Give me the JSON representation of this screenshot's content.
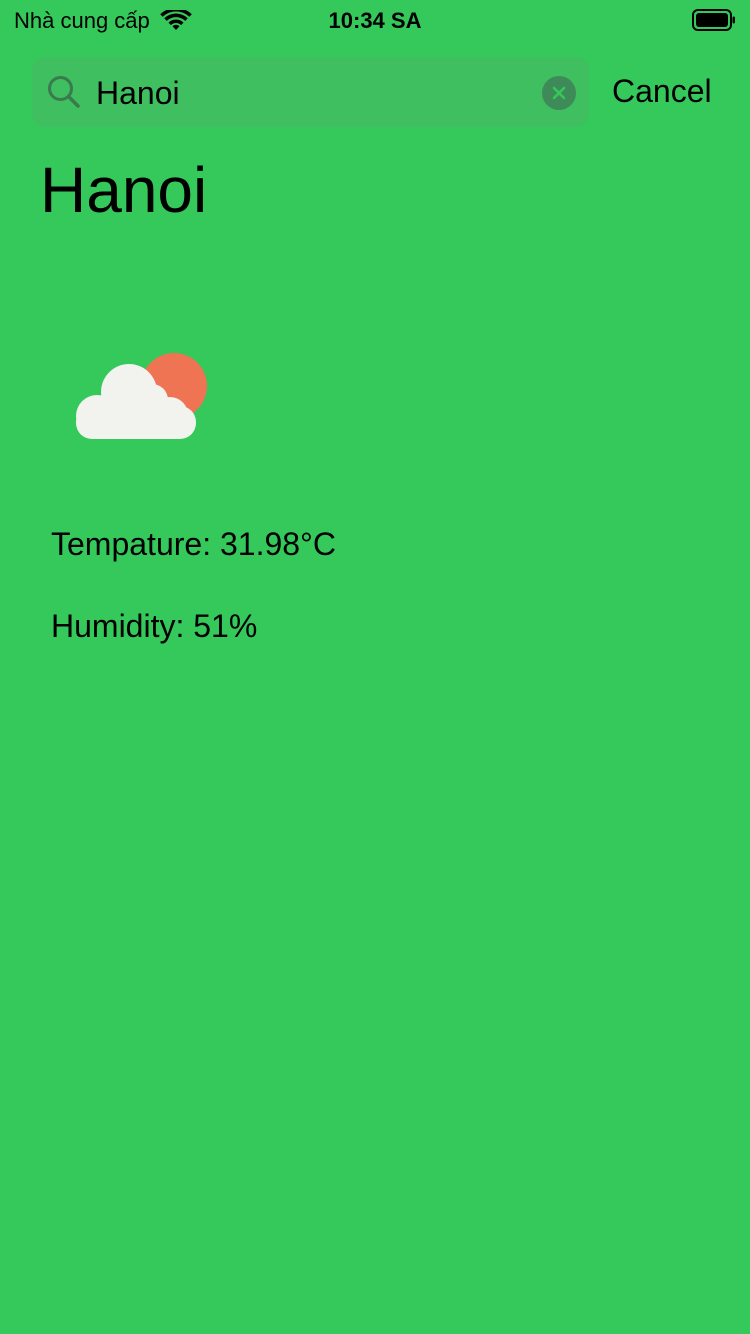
{
  "status_bar": {
    "carrier": "Nhà cung cấp",
    "time": "10:34 SA"
  },
  "search": {
    "query": "Hanoi",
    "cancel_label": "Cancel"
  },
  "city": {
    "name": "Hanoi"
  },
  "weather": {
    "icon": "partly-cloudy-day-icon",
    "temperature_label": "Tempature:",
    "temperature_value": "31.98°C",
    "humidity_label": "Humidity:",
    "humidity_value": "51%"
  },
  "colors": {
    "background": "#35c85a",
    "search_field": "#3fbf5f",
    "sun": "#ef7453",
    "cloud": "#f2f2ef"
  }
}
